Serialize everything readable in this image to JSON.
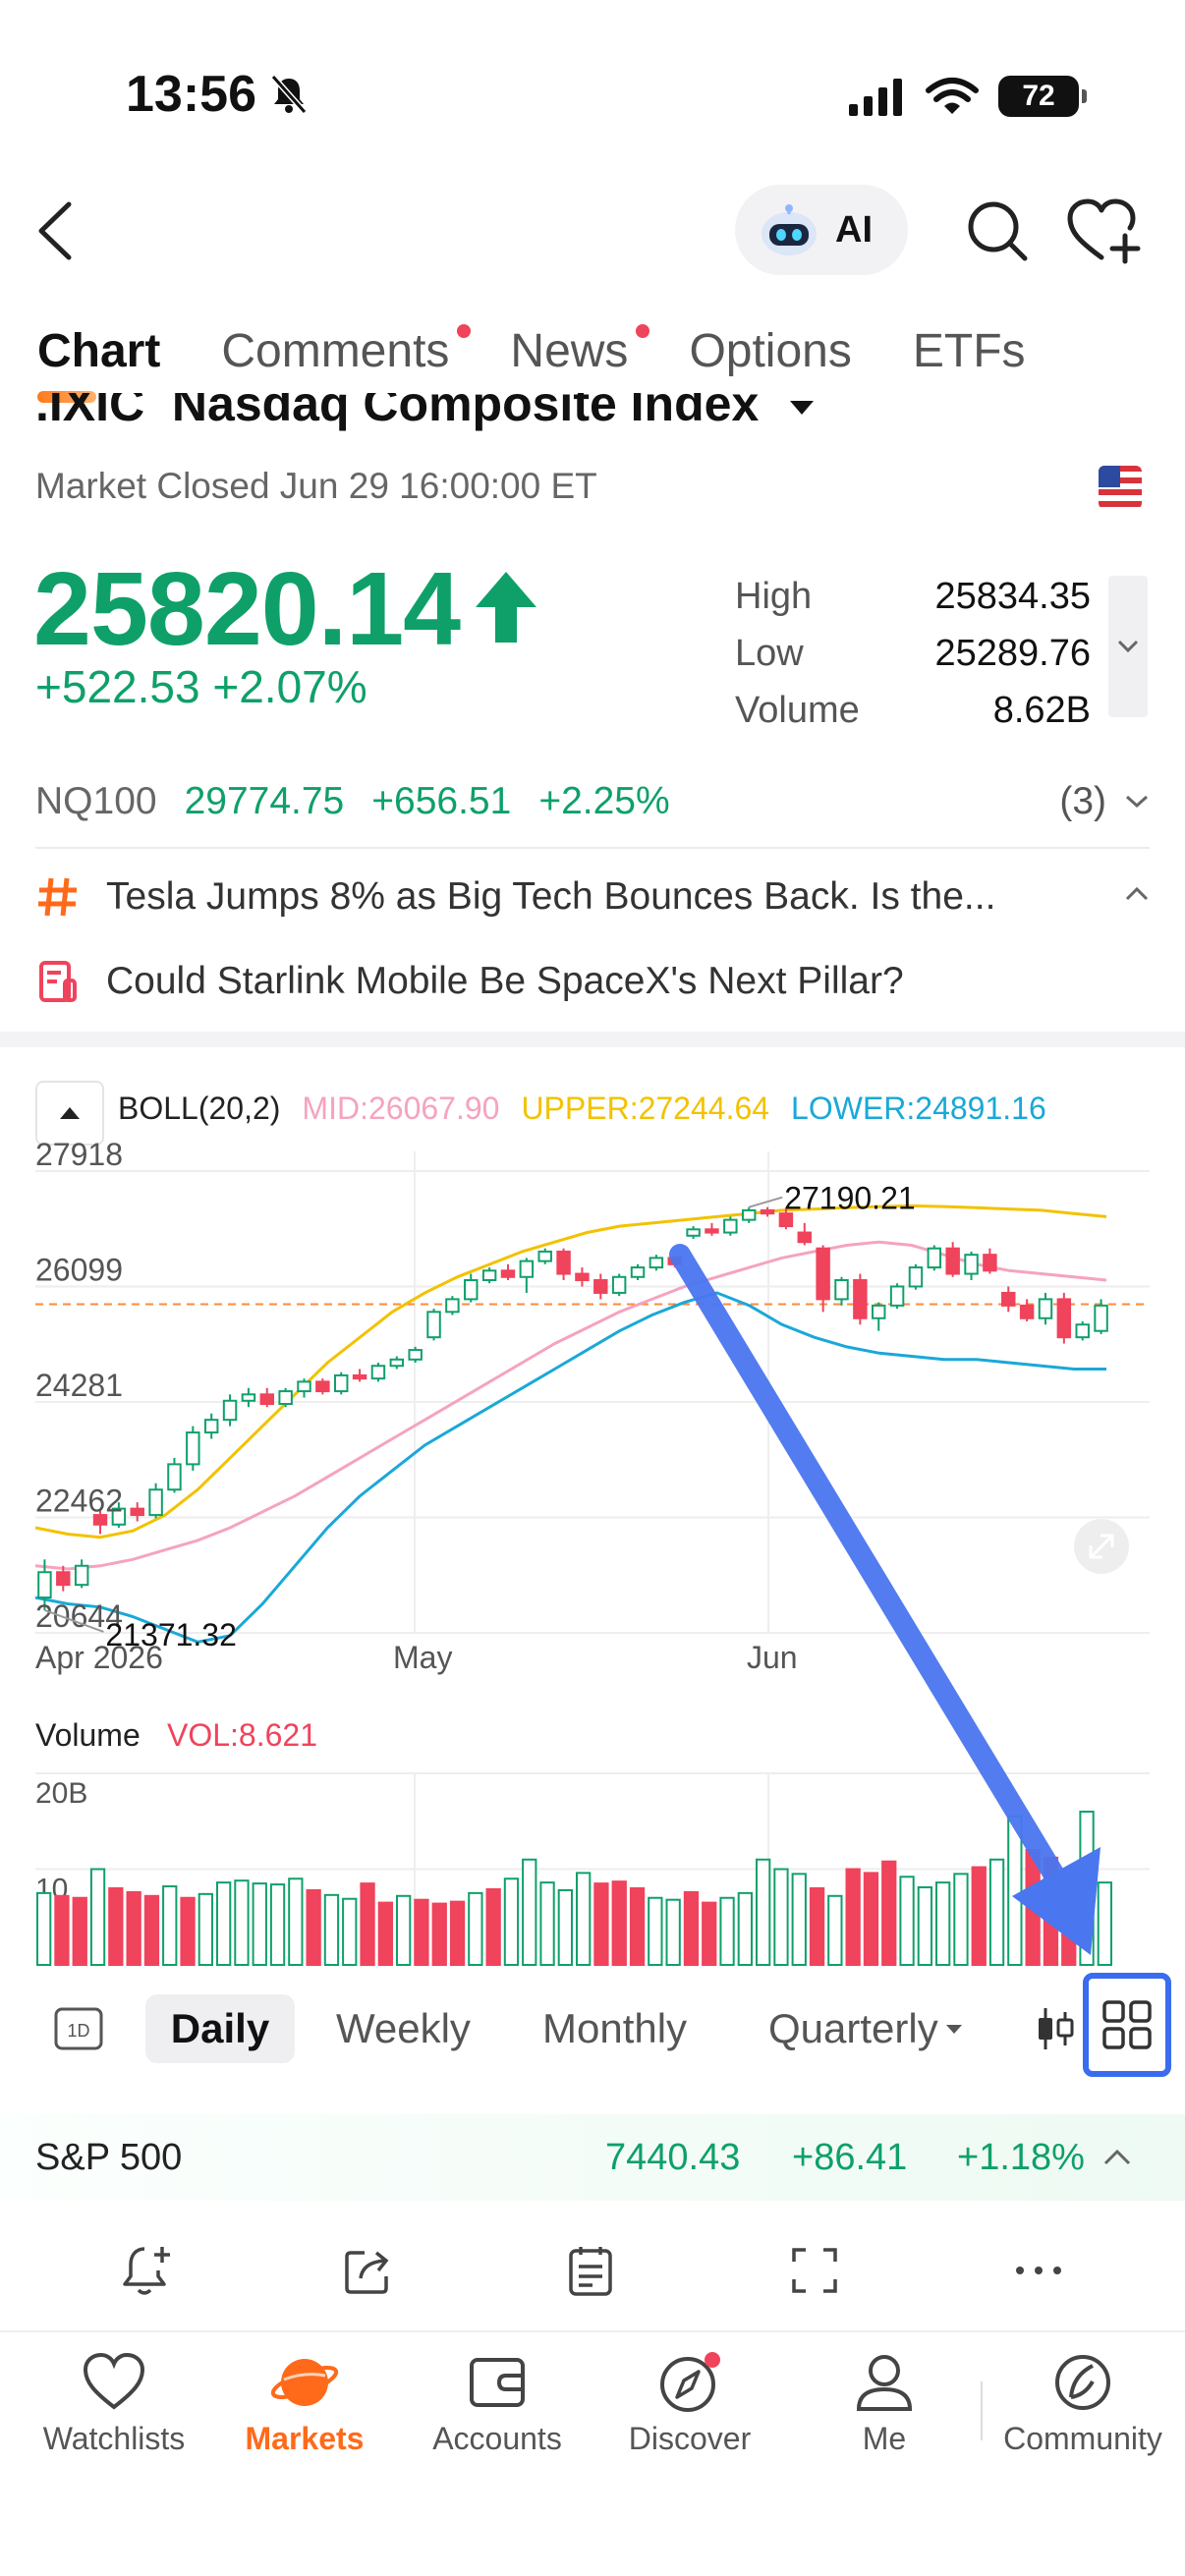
{
  "status_bar": {
    "time": "13:56",
    "battery": "72"
  },
  "header": {
    "ai_label": "AI"
  },
  "tabs": [
    {
      "label": "Chart",
      "active": true,
      "dot": false
    },
    {
      "label": "Comments",
      "dot": true
    },
    {
      "label": "News",
      "dot": true
    },
    {
      "label": "Options",
      "dot": false
    },
    {
      "label": "ETFs",
      "dot": false
    }
  ],
  "quote": {
    "title": ".IXIC  Nasdaq Composite Index",
    "market_status": "Market Closed Jun 29 16:00:00 ET",
    "price": "25820.14",
    "change": "+522.53 +2.07%",
    "stats": [
      {
        "label": "High",
        "value": "25834.35"
      },
      {
        "label": "Low",
        "value": "25289.76"
      },
      {
        "label": "Volume",
        "value": "8.62B"
      }
    ]
  },
  "related": {
    "symbol": "NQ100",
    "price": "29774.75",
    "change": "+656.51",
    "pct": "+2.25%",
    "count": "(3)"
  },
  "news": [
    {
      "text": "Tesla Jumps 8% as Big Tech Bounces Back. Is the..."
    },
    {
      "text": "Could Starlink Mobile Be SpaceX's Next Pillar?"
    }
  ],
  "indicator": {
    "name": "BOLL(20,2)",
    "mid": "MID:26067.90",
    "upper": "UPPER:27244.64",
    "lower": "LOWER:24891.16",
    "colors": {
      "mid": "#f5a3c0",
      "upper": "#f2c200",
      "lower": "#1aa8d8",
      "up": "#0fa06a",
      "down": "#f0435c"
    }
  },
  "chart_data": {
    "type": "line",
    "y_ticks": [
      "27918",
      "26099",
      "24281",
      "22462",
      "20644"
    ],
    "ylim": [
      20644,
      27918
    ],
    "x_ticks": [
      "Apr 2026",
      "May",
      "Jun"
    ],
    "annotations": {
      "high": "27190.21",
      "low": "21371.32"
    },
    "reference_line": 25820.14,
    "candles": [
      [
        21200,
        21600,
        21800,
        21000
      ],
      [
        21600,
        21400,
        21700,
        21300
      ],
      [
        21400,
        21700,
        21800,
        21350
      ],
      [
        22500,
        22350,
        22600,
        22200
      ],
      [
        22350,
        22600,
        22700,
        22300
      ],
      [
        22600,
        22500,
        22700,
        22400
      ],
      [
        22500,
        22900,
        23000,
        22450
      ],
      [
        22900,
        23300,
        23400,
        22850
      ],
      [
        23300,
        23800,
        23900,
        23200
      ],
      [
        23800,
        24000,
        24100,
        23700
      ],
      [
        24000,
        24300,
        24400,
        23900
      ],
      [
        24300,
        24400,
        24500,
        24200
      ],
      [
        24400,
        24250,
        24500,
        24200
      ],
      [
        24250,
        24450,
        24500,
        24200
      ],
      [
        24450,
        24600,
        24650,
        24350
      ],
      [
        24600,
        24450,
        24650,
        24400
      ],
      [
        24450,
        24700,
        24750,
        24400
      ],
      [
        24700,
        24650,
        24800,
        24600
      ],
      [
        24650,
        24850,
        24900,
        24600
      ],
      [
        24850,
        24950,
        25000,
        24800
      ],
      [
        24950,
        25100,
        25150,
        24900
      ],
      [
        25300,
        25700,
        25750,
        25250
      ],
      [
        25700,
        25900,
        25950,
        25650
      ],
      [
        25900,
        26200,
        26300,
        25850
      ],
      [
        26200,
        26350,
        26400,
        26150
      ],
      [
        26350,
        26250,
        26450,
        26200
      ],
      [
        26250,
        26500,
        26550,
        26000
      ],
      [
        26500,
        26650,
        26700,
        26450
      ],
      [
        26650,
        26300,
        26700,
        26200
      ],
      [
        26300,
        26200,
        26400,
        26100
      ],
      [
        26200,
        26000,
        26300,
        25900
      ],
      [
        26000,
        26250,
        26300,
        25950
      ],
      [
        26250,
        26400,
        26450,
        26200
      ],
      [
        26400,
        26550,
        26600,
        26350
      ],
      [
        26550,
        26450,
        26600,
        26400
      ],
      [
        26900,
        27000,
        27050,
        26850
      ],
      [
        27000,
        26950,
        27100,
        26900
      ],
      [
        26950,
        27150,
        27200,
        26900
      ],
      [
        27150,
        27300,
        27350,
        27100
      ],
      [
        27300,
        27250,
        27350,
        27200
      ],
      [
        27250,
        27050,
        27350,
        27000
      ],
      [
        26950,
        26800,
        27100,
        26750
      ],
      [
        26700,
        25900,
        26750,
        25700
      ],
      [
        25900,
        26200,
        26250,
        25800
      ],
      [
        26200,
        25600,
        26300,
        25500
      ],
      [
        25600,
        25800,
        25850,
        25400
      ],
      [
        25800,
        26100,
        26150,
        25750
      ],
      [
        26100,
        26400,
        26450,
        26050
      ],
      [
        26400,
        26700,
        26750,
        26350
      ],
      [
        26700,
        26300,
        26800,
        26250
      ],
      [
        26300,
        26600,
        26650,
        26200
      ],
      [
        26600,
        26350,
        26700,
        26300
      ],
      [
        26000,
        25800,
        26100,
        25700
      ],
      [
        25800,
        25600,
        25900,
        25550
      ],
      [
        25600,
        25900,
        26000,
        25500
      ],
      [
        25900,
        25300,
        26000,
        25200
      ],
      [
        25300,
        25500,
        25550,
        25250
      ],
      [
        25400,
        25800,
        25900,
        25350
      ]
    ],
    "bands": {
      "upper": [
        22300,
        22200,
        22150,
        22250,
        22500,
        22900,
        23400,
        23900,
        24400,
        24900,
        25300,
        25700,
        26000,
        26250,
        26450,
        26650,
        26800,
        26950,
        27050,
        27100,
        27150,
        27200,
        27250,
        27300,
        27320,
        27340,
        27360,
        27370,
        27360,
        27340,
        27320,
        27300,
        27250,
        27200
      ],
      "mid": [
        21700,
        21650,
        21700,
        21800,
        21950,
        22100,
        22300,
        22550,
        22800,
        23100,
        23400,
        23700,
        24000,
        24300,
        24600,
        24900,
        25200,
        25450,
        25700,
        25900,
        26100,
        26250,
        26400,
        26550,
        26650,
        26750,
        26800,
        26750,
        26600,
        26450,
        26350,
        26300,
        26250,
        26200
      ],
      "lower": [
        21200,
        21100,
        21050,
        20900,
        20700,
        20500,
        20600,
        21100,
        21700,
        22300,
        22800,
        23200,
        23600,
        23900,
        24200,
        24500,
        24800,
        25100,
        25400,
        25650,
        25850,
        26000,
        25800,
        25500,
        25300,
        25150,
        25050,
        25000,
        24950,
        24950,
        24900,
        24850,
        24800,
        24800
      ]
    }
  },
  "volume": {
    "label": "Volume",
    "value": "VOL:8.621",
    "ticks": [
      "20B",
      "10"
    ],
    "ylim": [
      0,
      20
    ],
    "bars": [
      [
        7.5,
        1
      ],
      [
        7.2,
        0
      ],
      [
        7.0,
        0
      ],
      [
        10.0,
        1
      ],
      [
        8.0,
        0
      ],
      [
        7.6,
        0
      ],
      [
        7.2,
        0
      ],
      [
        8.2,
        1
      ],
      [
        7.0,
        0
      ],
      [
        7.4,
        1
      ],
      [
        8.6,
        1
      ],
      [
        8.8,
        1
      ],
      [
        8.5,
        1
      ],
      [
        8.4,
        1
      ],
      [
        9.0,
        1
      ],
      [
        7.8,
        0
      ],
      [
        7.3,
        1
      ],
      [
        6.9,
        1
      ],
      [
        8.5,
        0
      ],
      [
        6.5,
        0
      ],
      [
        7.2,
        1
      ],
      [
        6.8,
        0
      ],
      [
        6.4,
        0
      ],
      [
        6.6,
        0
      ],
      [
        7.5,
        1
      ],
      [
        7.9,
        0
      ],
      [
        9.0,
        1
      ],
      [
        11.0,
        1
      ],
      [
        8.6,
        1
      ],
      [
        7.8,
        1
      ],
      [
        9.6,
        1
      ],
      [
        8.5,
        0
      ],
      [
        8.7,
        0
      ],
      [
        8.0,
        0
      ],
      [
        7.0,
        1
      ],
      [
        6.8,
        1
      ],
      [
        7.6,
        0
      ],
      [
        6.5,
        0
      ],
      [
        7.0,
        1
      ],
      [
        7.5,
        1
      ],
      [
        11.0,
        1
      ],
      [
        10.0,
        1
      ],
      [
        9.5,
        1
      ],
      [
        8.0,
        0
      ],
      [
        7.2,
        1
      ],
      [
        10.0,
        0
      ],
      [
        9.6,
        0
      ],
      [
        10.8,
        0
      ],
      [
        9.2,
        1
      ],
      [
        8.1,
        1
      ],
      [
        8.6,
        1
      ],
      [
        9.5,
        1
      ],
      [
        10.2,
        0
      ],
      [
        11.0,
        1
      ],
      [
        15.5,
        1
      ],
      [
        12.0,
        0
      ],
      [
        11.2,
        0
      ],
      [
        8.5,
        0
      ],
      [
        16.0,
        1
      ],
      [
        8.6,
        1
      ]
    ]
  },
  "periods": [
    "Daily",
    "Weekly",
    "Monthly",
    "Quarterly"
  ],
  "period_1d": "1D",
  "sp500": {
    "name": "S&P 500",
    "price": "7440.43",
    "change": "+86.41",
    "pct": "+1.18%"
  },
  "nav": [
    {
      "label": "Watchlists"
    },
    {
      "label": "Markets",
      "active": true
    },
    {
      "label": "Accounts"
    },
    {
      "label": "Discover"
    },
    {
      "label": "Me"
    },
    {
      "label": "Community"
    }
  ]
}
